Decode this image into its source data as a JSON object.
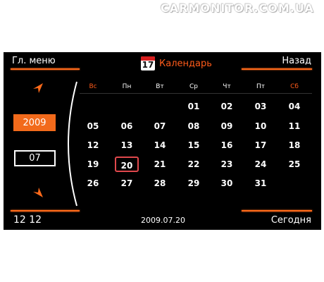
{
  "watermark": "CARMONITOR.COM.UA",
  "header": {
    "main_menu": "Гл. меню",
    "title": "Календарь",
    "icon_day": "17",
    "back": "Назад"
  },
  "sidebar": {
    "year": "2009",
    "month": "07"
  },
  "weekdays": [
    "Вс",
    "Пн",
    "Вт",
    "Ср",
    "Чт",
    "Пт",
    "Сб"
  ],
  "weeks": [
    [
      "",
      "",
      "",
      "01",
      "02",
      "03",
      "04"
    ],
    [
      "05",
      "06",
      "07",
      "08",
      "09",
      "10",
      "11"
    ],
    [
      "12",
      "13",
      "14",
      "15",
      "16",
      "17",
      "18"
    ],
    [
      "19",
      "20",
      "21",
      "22",
      "23",
      "24",
      "25"
    ],
    [
      "26",
      "27",
      "28",
      "29",
      "30",
      "31",
      ""
    ]
  ],
  "selected_day": "20",
  "footer": {
    "clock": "12 12",
    "date": "2009.07.20",
    "today": "Сегодня"
  },
  "colors": {
    "accent": "#ff6a1a",
    "weekend": "#ff5b1a",
    "selected_border": "#e0484c",
    "background": "#000000"
  }
}
